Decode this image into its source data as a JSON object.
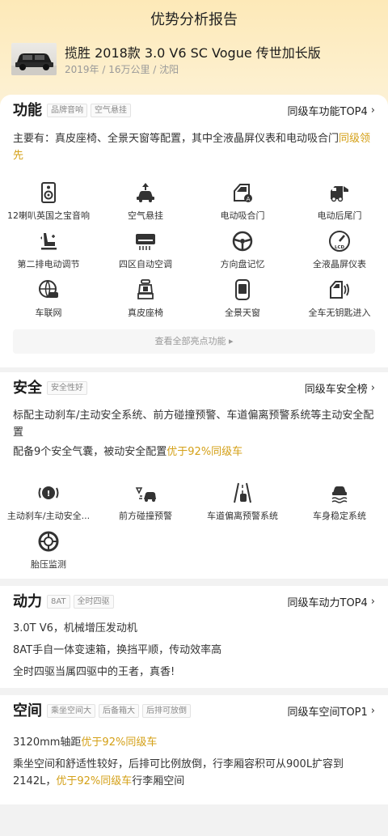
{
  "page": {
    "title": "优势分析报告"
  },
  "car": {
    "name": "揽胜 2018款 3.0 V6 SC Vogue 传世加长版",
    "meta": "2019年 / 16万公里 / 沈阳"
  },
  "function_section": {
    "title": "功能",
    "tags": [
      "品牌音响",
      "空气悬挂"
    ],
    "rank": "同级车功能TOP4",
    "desc_main": "主要有：真皮座椅、全景天窗等配置，其中全液晶屏仪表和电动吸合门",
    "desc_highlight": "同级领先",
    "features": [
      {
        "label": "12喇叭英国之宝音响",
        "icon": "speaker-icon"
      },
      {
        "label": "空气悬挂",
        "icon": "air-suspension-icon"
      },
      {
        "label": "电动吸合门",
        "icon": "door-icon"
      },
      {
        "label": "电动后尾门",
        "icon": "tailgate-icon"
      },
      {
        "label": "第二排电动调节",
        "icon": "seat-adjust-icon"
      },
      {
        "label": "四区自动空调",
        "icon": "air-conditioner-icon"
      },
      {
        "label": "方向盘记忆",
        "icon": "steering-wheel-icon"
      },
      {
        "label": "全液晶屏仪表",
        "icon": "lcd-gauge-icon"
      },
      {
        "label": "车联网",
        "icon": "connected-car-icon"
      },
      {
        "label": "真皮座椅",
        "icon": "leather-seat-icon"
      },
      {
        "label": "全景天窗",
        "icon": "sunroof-icon"
      },
      {
        "label": "全车无钥匙进入",
        "icon": "keyless-entry-icon"
      }
    ],
    "view_all": "查看全部亮点功能 ▸"
  },
  "safety_section": {
    "title": "安全",
    "tags": [
      "安全性好"
    ],
    "rank": "同级车安全榜",
    "desc1": "标配主动刹车/主动安全系统、前方碰撞预警、车道偏离预警系统等主动安全配置",
    "desc2_main": "配备9个安全气囊，被动安全配置",
    "desc2_highlight": "优于92%同级车",
    "features": [
      {
        "label": "主动刹车/主动安全...",
        "icon": "brake-icon"
      },
      {
        "label": "前方碰撞预警",
        "icon": "collision-warning-icon"
      },
      {
        "label": "车道偏离预警系统",
        "icon": "lane-departure-icon"
      },
      {
        "label": "车身稳定系统",
        "icon": "stability-icon"
      },
      {
        "label": "胎压监测",
        "icon": "tire-pressure-icon"
      }
    ]
  },
  "power_section": {
    "title": "动力",
    "tags": [
      "8AT",
      "全时四驱"
    ],
    "rank": "同级车动力TOP4",
    "lines": [
      "3.0T V6，机械增压发动机",
      "8AT手自一体变速箱，换挡平顺，传动效率高",
      "全时四驱当属四驱中的王者，真香!"
    ]
  },
  "space_section": {
    "title": "空间",
    "tags": [
      "乘坐空间大",
      "后备箱大",
      "后排可放倒"
    ],
    "rank": "同级车空间TOP1",
    "line1_main": "3120mm轴距",
    "line1_highlight": "优于92%同级车",
    "line2_a": "乘坐空间和舒适性较好，后排可比例放倒，行李厢容积可从900L扩容到2142L，",
    "line2_highlight": "优于92%同级车",
    "line2_b": "行李厢空间"
  },
  "colors": {
    "highlight": "#d4a017",
    "icon": "#333333"
  }
}
